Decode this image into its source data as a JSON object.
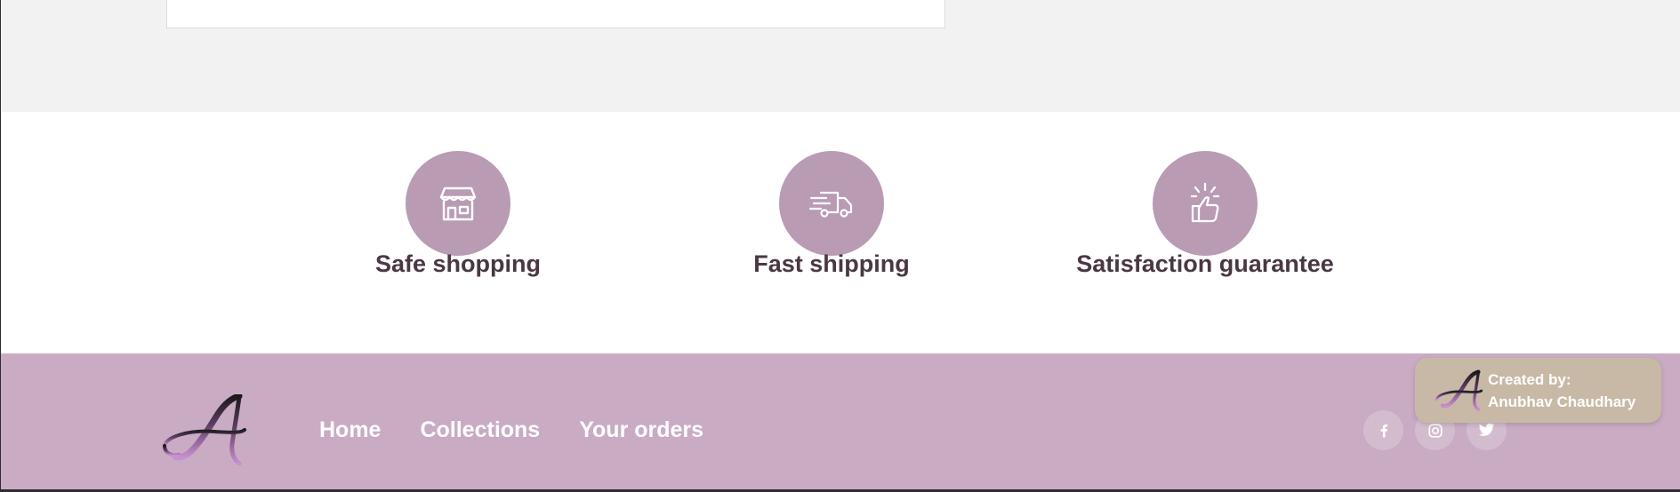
{
  "colors": {
    "top_background": "#f2f2f2",
    "features_background": "#ffffff",
    "feature_circle": "#b99bb4",
    "feature_text": "#4a3744",
    "footer_background": "#c9abc4",
    "social_button": "#d4bccf",
    "credit_background": "#c8b9a6"
  },
  "features": [
    {
      "title": "Safe shopping",
      "icon": "storefront-icon"
    },
    {
      "title": "Fast shipping",
      "icon": "delivery-truck-icon"
    },
    {
      "title": "Satisfaction guarantee",
      "icon": "thumbs-up-icon"
    }
  ],
  "footer": {
    "logo_icon": "brand-logo-icon",
    "nav": [
      {
        "label": "Home"
      },
      {
        "label": "Collections"
      },
      {
        "label": "Your orders"
      }
    ],
    "socials": [
      {
        "icon": "facebook-icon"
      },
      {
        "icon": "instagram-icon"
      },
      {
        "icon": "twitter-icon"
      }
    ]
  },
  "credit": {
    "line1": "Created by:",
    "line2": "Anubhav Chaudhary"
  }
}
